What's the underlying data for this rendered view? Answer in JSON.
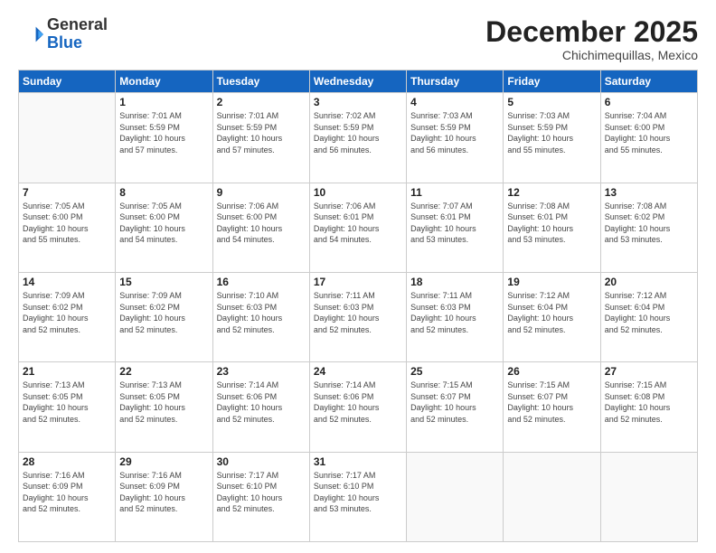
{
  "logo": {
    "general": "General",
    "blue": "Blue"
  },
  "header": {
    "month": "December 2025",
    "location": "Chichimequillas, Mexico"
  },
  "weekdays": [
    "Sunday",
    "Monday",
    "Tuesday",
    "Wednesday",
    "Thursday",
    "Friday",
    "Saturday"
  ],
  "weeks": [
    [
      {
        "day": "",
        "info": ""
      },
      {
        "day": "1",
        "info": "Sunrise: 7:01 AM\nSunset: 5:59 PM\nDaylight: 10 hours\nand 57 minutes."
      },
      {
        "day": "2",
        "info": "Sunrise: 7:01 AM\nSunset: 5:59 PM\nDaylight: 10 hours\nand 57 minutes."
      },
      {
        "day": "3",
        "info": "Sunrise: 7:02 AM\nSunset: 5:59 PM\nDaylight: 10 hours\nand 56 minutes."
      },
      {
        "day": "4",
        "info": "Sunrise: 7:03 AM\nSunset: 5:59 PM\nDaylight: 10 hours\nand 56 minutes."
      },
      {
        "day": "5",
        "info": "Sunrise: 7:03 AM\nSunset: 5:59 PM\nDaylight: 10 hours\nand 55 minutes."
      },
      {
        "day": "6",
        "info": "Sunrise: 7:04 AM\nSunset: 6:00 PM\nDaylight: 10 hours\nand 55 minutes."
      }
    ],
    [
      {
        "day": "7",
        "info": "Sunrise: 7:05 AM\nSunset: 6:00 PM\nDaylight: 10 hours\nand 55 minutes."
      },
      {
        "day": "8",
        "info": "Sunrise: 7:05 AM\nSunset: 6:00 PM\nDaylight: 10 hours\nand 54 minutes."
      },
      {
        "day": "9",
        "info": "Sunrise: 7:06 AM\nSunset: 6:00 PM\nDaylight: 10 hours\nand 54 minutes."
      },
      {
        "day": "10",
        "info": "Sunrise: 7:06 AM\nSunset: 6:01 PM\nDaylight: 10 hours\nand 54 minutes."
      },
      {
        "day": "11",
        "info": "Sunrise: 7:07 AM\nSunset: 6:01 PM\nDaylight: 10 hours\nand 53 minutes."
      },
      {
        "day": "12",
        "info": "Sunrise: 7:08 AM\nSunset: 6:01 PM\nDaylight: 10 hours\nand 53 minutes."
      },
      {
        "day": "13",
        "info": "Sunrise: 7:08 AM\nSunset: 6:02 PM\nDaylight: 10 hours\nand 53 minutes."
      }
    ],
    [
      {
        "day": "14",
        "info": "Sunrise: 7:09 AM\nSunset: 6:02 PM\nDaylight: 10 hours\nand 52 minutes."
      },
      {
        "day": "15",
        "info": "Sunrise: 7:09 AM\nSunset: 6:02 PM\nDaylight: 10 hours\nand 52 minutes."
      },
      {
        "day": "16",
        "info": "Sunrise: 7:10 AM\nSunset: 6:03 PM\nDaylight: 10 hours\nand 52 minutes."
      },
      {
        "day": "17",
        "info": "Sunrise: 7:11 AM\nSunset: 6:03 PM\nDaylight: 10 hours\nand 52 minutes."
      },
      {
        "day": "18",
        "info": "Sunrise: 7:11 AM\nSunset: 6:03 PM\nDaylight: 10 hours\nand 52 minutes."
      },
      {
        "day": "19",
        "info": "Sunrise: 7:12 AM\nSunset: 6:04 PM\nDaylight: 10 hours\nand 52 minutes."
      },
      {
        "day": "20",
        "info": "Sunrise: 7:12 AM\nSunset: 6:04 PM\nDaylight: 10 hours\nand 52 minutes."
      }
    ],
    [
      {
        "day": "21",
        "info": "Sunrise: 7:13 AM\nSunset: 6:05 PM\nDaylight: 10 hours\nand 52 minutes."
      },
      {
        "day": "22",
        "info": "Sunrise: 7:13 AM\nSunset: 6:05 PM\nDaylight: 10 hours\nand 52 minutes."
      },
      {
        "day": "23",
        "info": "Sunrise: 7:14 AM\nSunset: 6:06 PM\nDaylight: 10 hours\nand 52 minutes."
      },
      {
        "day": "24",
        "info": "Sunrise: 7:14 AM\nSunset: 6:06 PM\nDaylight: 10 hours\nand 52 minutes."
      },
      {
        "day": "25",
        "info": "Sunrise: 7:15 AM\nSunset: 6:07 PM\nDaylight: 10 hours\nand 52 minutes."
      },
      {
        "day": "26",
        "info": "Sunrise: 7:15 AM\nSunset: 6:07 PM\nDaylight: 10 hours\nand 52 minutes."
      },
      {
        "day": "27",
        "info": "Sunrise: 7:15 AM\nSunset: 6:08 PM\nDaylight: 10 hours\nand 52 minutes."
      }
    ],
    [
      {
        "day": "28",
        "info": "Sunrise: 7:16 AM\nSunset: 6:09 PM\nDaylight: 10 hours\nand 52 minutes."
      },
      {
        "day": "29",
        "info": "Sunrise: 7:16 AM\nSunset: 6:09 PM\nDaylight: 10 hours\nand 52 minutes."
      },
      {
        "day": "30",
        "info": "Sunrise: 7:17 AM\nSunset: 6:10 PM\nDaylight: 10 hours\nand 52 minutes."
      },
      {
        "day": "31",
        "info": "Sunrise: 7:17 AM\nSunset: 6:10 PM\nDaylight: 10 hours\nand 53 minutes."
      },
      {
        "day": "",
        "info": ""
      },
      {
        "day": "",
        "info": ""
      },
      {
        "day": "",
        "info": ""
      }
    ]
  ]
}
